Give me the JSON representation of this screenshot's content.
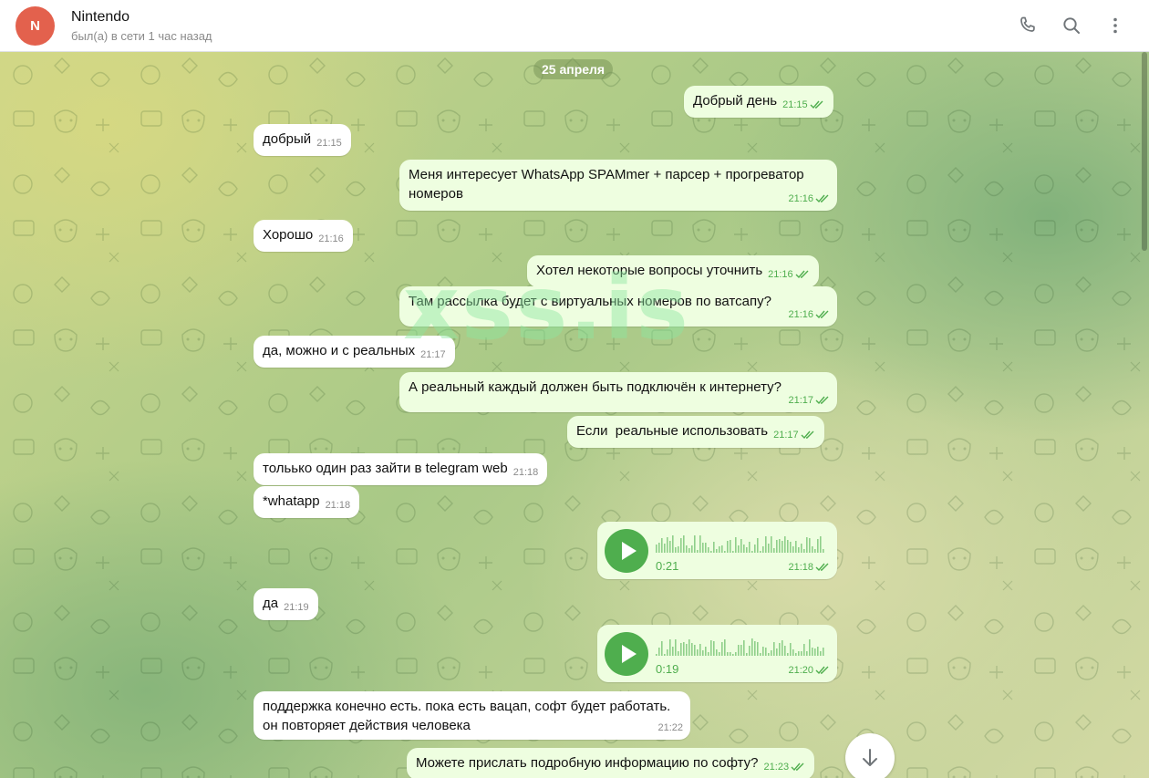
{
  "header": {
    "avatar_letter": "N",
    "name": "Nintendo",
    "status": "был(а) в сети 1 час назад",
    "icons": [
      "phone-icon",
      "search-icon",
      "more-vertical-icon"
    ]
  },
  "chat": {
    "date": "25 апреля",
    "watermark": "xss.is",
    "messages": [
      {
        "dir": "out",
        "text": "Добрый день",
        "time": "21:15"
      },
      {
        "dir": "in",
        "text": "добрый",
        "time": "21:15"
      },
      {
        "dir": "out",
        "text": "Меня интересует WhatsApp SPAMmer + парсер + прогреватор номеров",
        "time": "21:16"
      },
      {
        "dir": "in",
        "text": "Хорошо",
        "time": "21:16"
      },
      {
        "dir": "out",
        "text": "Хотел некоторые вопросы уточнить",
        "time": "21:16"
      },
      {
        "dir": "out",
        "text": "Там рассылка будет с виртуальных номеров по ватсапу?",
        "time": "21:16"
      },
      {
        "dir": "in",
        "text": "да, можно и с реальных",
        "time": "21:17"
      },
      {
        "dir": "out",
        "text": "А реальный каждый должен быть подключён к интернету?",
        "time": "21:17"
      },
      {
        "dir": "out",
        "text": "Если  реальные использовать",
        "time": "21:17"
      },
      {
        "dir": "in",
        "text": "тольько один раз зайти в telegram web",
        "time": "21:18"
      },
      {
        "dir": "in",
        "text": "*whatapp",
        "time": "21:18"
      },
      {
        "dir": "out",
        "type": "voice",
        "duration": "0:21",
        "time": "21:18"
      },
      {
        "dir": "in",
        "text": "да",
        "time": "21:19"
      },
      {
        "dir": "out",
        "type": "voice",
        "duration": "0:19",
        "time": "21:20"
      },
      {
        "dir": "in",
        "text": "поддержка конечно есть. пока есть вацап, софт будет работать. он повторяет действия человека",
        "time": "21:22"
      },
      {
        "dir": "out",
        "text": "Можете прислать подробную информацию по софту?",
        "time": "21:23"
      }
    ]
  },
  "colors": {
    "accent": "#4fae4e",
    "avatar": "#e3614d",
    "bubble_out": "#eefee0",
    "bubble_in": "#ffffff"
  }
}
